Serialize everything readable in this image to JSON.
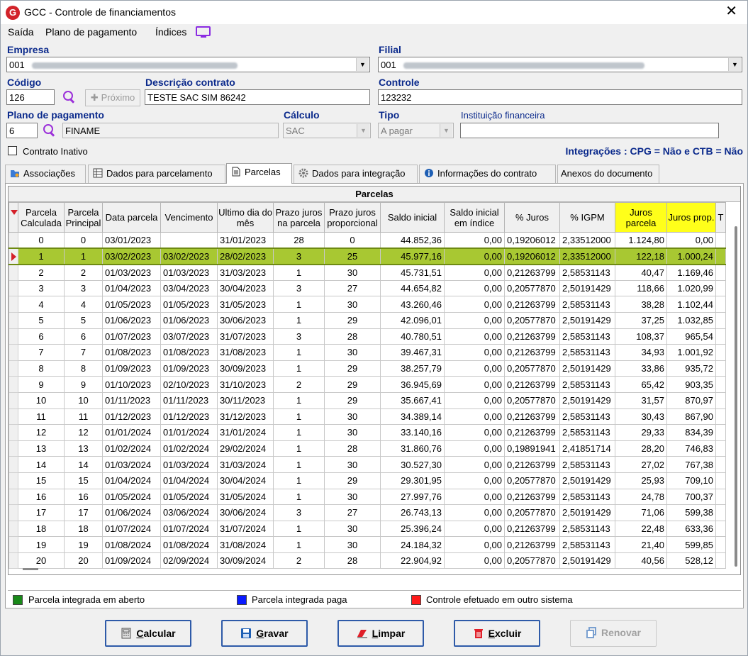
{
  "window": {
    "title": "GCC - Controle de financiamentos",
    "close": "✕"
  },
  "menu": [
    "Saída",
    "Plano de pagamento",
    "Índices"
  ],
  "form": {
    "empresa_label": "Empresa",
    "empresa_value": "001",
    "filial_label": "Filial",
    "filial_value": "001",
    "codigo_label": "Código",
    "codigo_value": "126",
    "proximo_label": "Próximo",
    "descricao_label": "Descrição contrato",
    "descricao_value": "TESTE SAC SIM 86242",
    "controle_label": "Controle",
    "controle_value": "123232",
    "plano_label": "Plano de pagamento",
    "plano_code": "6",
    "plano_name": "FINAME",
    "calculo_label": "Cálculo",
    "calculo_value": "SAC",
    "tipo_label": "Tipo",
    "tipo_value": "A pagar",
    "instituicao_label": "Instituição financeira",
    "instituicao_value": "",
    "contrato_inativo_label": "Contrato Inativo",
    "integracoes": "Integrações : CPG = Não e CTB = Não"
  },
  "tabs": [
    "Associações",
    "Dados para parcelamento",
    "Parcelas",
    "Dados para integração",
    "Informações do contrato",
    "Anexos do documento"
  ],
  "grid": {
    "title": "Parcelas",
    "columns": [
      "Parcela Calculada",
      "Parcela Principal",
      "Data parcela",
      "Vencimento",
      "Ultimo dia do mês",
      "Prazo juros na parcela",
      "Prazo juros proporcional",
      "Saldo inicial",
      "Saldo inicial em índice",
      "% Juros",
      "% IGPM",
      "Juros parcela",
      "Juros prop.",
      "T"
    ],
    "rows": [
      [
        "0",
        "0",
        "03/01/2023",
        "",
        "31/01/2023",
        "28",
        "0",
        "44.852,36",
        "0,00",
        "0,19206012",
        "2,33512000",
        "1.124,80",
        "0,00"
      ],
      [
        "1",
        "1",
        "03/02/2023",
        "03/02/2023",
        "28/02/2023",
        "3",
        "25",
        "45.977,16",
        "0,00",
        "0,19206012",
        "2,33512000",
        "122,18",
        "1.000,24"
      ],
      [
        "2",
        "2",
        "01/03/2023",
        "01/03/2023",
        "31/03/2023",
        "1",
        "30",
        "45.731,51",
        "0,00",
        "0,21263799",
        "2,58531143",
        "40,47",
        "1.169,46"
      ],
      [
        "3",
        "3",
        "01/04/2023",
        "03/04/2023",
        "30/04/2023",
        "3",
        "27",
        "44.654,82",
        "0,00",
        "0,20577870",
        "2,50191429",
        "118,66",
        "1.020,99"
      ],
      [
        "4",
        "4",
        "01/05/2023",
        "01/05/2023",
        "31/05/2023",
        "1",
        "30",
        "43.260,46",
        "0,00",
        "0,21263799",
        "2,58531143",
        "38,28",
        "1.102,44"
      ],
      [
        "5",
        "5",
        "01/06/2023",
        "01/06/2023",
        "30/06/2023",
        "1",
        "29",
        "42.096,01",
        "0,00",
        "0,20577870",
        "2,50191429",
        "37,25",
        "1.032,85"
      ],
      [
        "6",
        "6",
        "01/07/2023",
        "03/07/2023",
        "31/07/2023",
        "3",
        "28",
        "40.780,51",
        "0,00",
        "0,21263799",
        "2,58531143",
        "108,37",
        "965,54"
      ],
      [
        "7",
        "7",
        "01/08/2023",
        "01/08/2023",
        "31/08/2023",
        "1",
        "30",
        "39.467,31",
        "0,00",
        "0,21263799",
        "2,58531143",
        "34,93",
        "1.001,92"
      ],
      [
        "8",
        "8",
        "01/09/2023",
        "01/09/2023",
        "30/09/2023",
        "1",
        "29",
        "38.257,79",
        "0,00",
        "0,20577870",
        "2,50191429",
        "33,86",
        "935,72"
      ],
      [
        "9",
        "9",
        "01/10/2023",
        "02/10/2023",
        "31/10/2023",
        "2",
        "29",
        "36.945,69",
        "0,00",
        "0,21263799",
        "2,58531143",
        "65,42",
        "903,35"
      ],
      [
        "10",
        "10",
        "01/11/2023",
        "01/11/2023",
        "30/11/2023",
        "1",
        "29",
        "35.667,41",
        "0,00",
        "0,20577870",
        "2,50191429",
        "31,57",
        "870,97"
      ],
      [
        "11",
        "11",
        "01/12/2023",
        "01/12/2023",
        "31/12/2023",
        "1",
        "30",
        "34.389,14",
        "0,00",
        "0,21263799",
        "2,58531143",
        "30,43",
        "867,90"
      ],
      [
        "12",
        "12",
        "01/01/2024",
        "01/01/2024",
        "31/01/2024",
        "1",
        "30",
        "33.140,16",
        "0,00",
        "0,21263799",
        "2,58531143",
        "29,33",
        "834,39"
      ],
      [
        "13",
        "13",
        "01/02/2024",
        "01/02/2024",
        "29/02/2024",
        "1",
        "28",
        "31.860,76",
        "0,00",
        "0,19891941",
        "2,41851714",
        "28,20",
        "746,83"
      ],
      [
        "14",
        "14",
        "01/03/2024",
        "01/03/2024",
        "31/03/2024",
        "1",
        "30",
        "30.527,30",
        "0,00",
        "0,21263799",
        "2,58531143",
        "27,02",
        "767,38"
      ],
      [
        "15",
        "15",
        "01/04/2024",
        "01/04/2024",
        "30/04/2024",
        "1",
        "29",
        "29.301,95",
        "0,00",
        "0,20577870",
        "2,50191429",
        "25,93",
        "709,10"
      ],
      [
        "16",
        "16",
        "01/05/2024",
        "01/05/2024",
        "31/05/2024",
        "1",
        "30",
        "27.997,76",
        "0,00",
        "0,21263799",
        "2,58531143",
        "24,78",
        "700,37"
      ],
      [
        "17",
        "17",
        "01/06/2024",
        "03/06/2024",
        "30/06/2024",
        "3",
        "27",
        "26.743,13",
        "0,00",
        "0,20577870",
        "2,50191429",
        "71,06",
        "599,38"
      ],
      [
        "18",
        "18",
        "01/07/2024",
        "01/07/2024",
        "31/07/2024",
        "1",
        "30",
        "25.396,24",
        "0,00",
        "0,21263799",
        "2,58531143",
        "22,48",
        "633,36"
      ],
      [
        "19",
        "19",
        "01/08/2024",
        "01/08/2024",
        "31/08/2024",
        "1",
        "30",
        "24.184,32",
        "0,00",
        "0,21263799",
        "2,58531143",
        "21,40",
        "599,85"
      ],
      [
        "20",
        "20",
        "01/09/2024",
        "02/09/2024",
        "30/09/2024",
        "2",
        "28",
        "22.904,92",
        "0,00",
        "0,20577870",
        "2,50191429",
        "40,56",
        "528,12"
      ]
    ],
    "selected_row_index": 1
  },
  "legend": [
    {
      "label": "Parcela integrada em aberto",
      "color": "#1a8a1a"
    },
    {
      "label": "Parcela integrada paga",
      "color": "#0a1aff"
    },
    {
      "label": "Controle efetuado em outro sistema",
      "color": "#ff1a1a"
    }
  ],
  "buttons": {
    "calcular": {
      "first": "C",
      "rest": "alcular"
    },
    "gravar": {
      "first": "G",
      "rest": "ravar"
    },
    "limpar": {
      "first": "L",
      "rest": "impar"
    },
    "excluir": {
      "first": "E",
      "rest": "xcluir"
    },
    "renovar": "Renovar"
  },
  "colors": {
    "accent": "#0b2a8c",
    "selected_row": "#a8c832",
    "highlight_header": "#ffff1a",
    "button_border": "#2e5aa8"
  },
  "icons": {
    "app": "gcc-logo-icon",
    "indices": "monitor-icon",
    "search": "magnifier-icon",
    "close": "close-icon"
  }
}
